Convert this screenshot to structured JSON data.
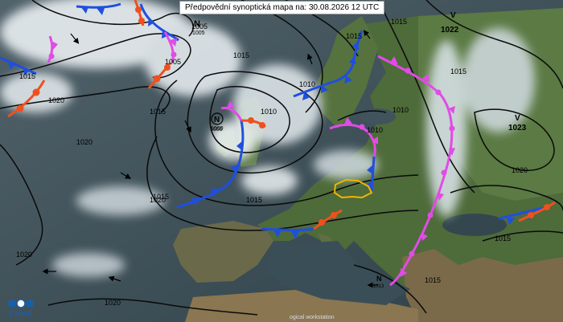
{
  "title": "Předpovědní synoptická mapa na: 30.08.2026 12 UTC",
  "logo": {
    "text": "ČHMÚ"
  },
  "footer": "ogical workstation",
  "isobar_labels": [
    "1005",
    "1010",
    "1015",
    "1020",
    "1015",
    "1010",
    "1015",
    "1020",
    "1010",
    "1005",
    "1015",
    "1020",
    "1020",
    "1015",
    "1015",
    "1022",
    "1023",
    "1020",
    "1015",
    "1015",
    "1020",
    "1000",
    "1010",
    "1015",
    "1015"
  ],
  "pressure_centres": [
    {
      "letter": "N",
      "value": "1005"
    },
    {
      "letter": "N",
      "value": "1000"
    },
    {
      "letter": "V",
      "value": "1022"
    },
    {
      "letter": "V",
      "value": "1023"
    },
    {
      "letter": "N",
      "value": "1013"
    }
  ],
  "colors": {
    "cold_front": "#1f4fe0",
    "warm_front": "#f0501e",
    "occluded_front": "#e14be6",
    "isobar": "#0a0a0a",
    "country_highlight": "#f2b400"
  }
}
